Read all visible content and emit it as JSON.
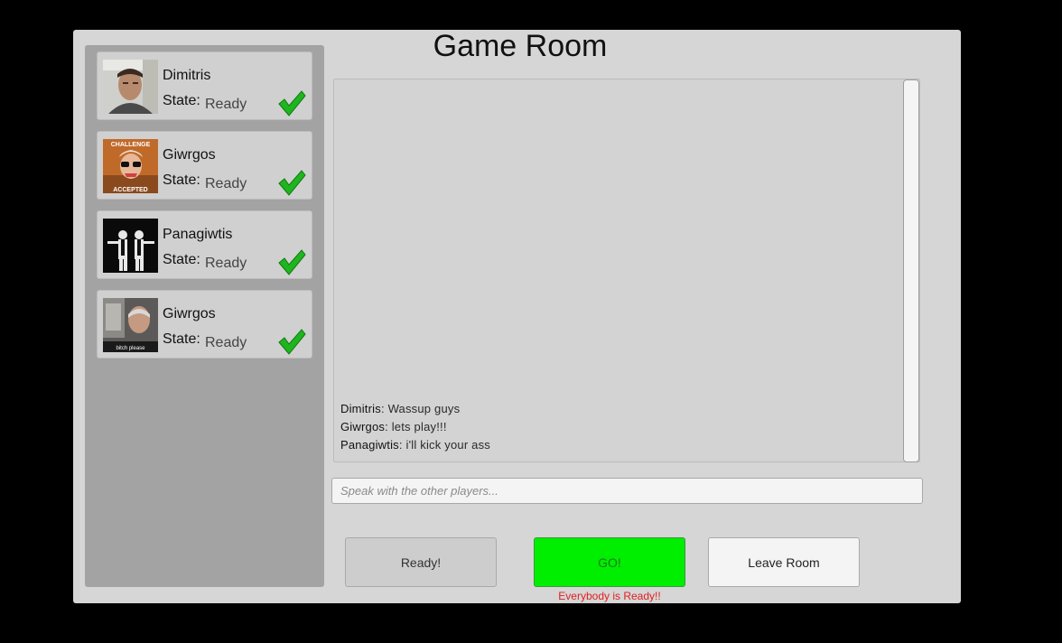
{
  "room": {
    "title": "Game Room"
  },
  "players": [
    {
      "name": "Dimitris",
      "state_label": "State:",
      "state": "Ready",
      "avatar_icon": "portrait-man-icon"
    },
    {
      "name": "Giwrgos",
      "state_label": "State:",
      "state": "Ready",
      "avatar_icon": "challenge-accepted-meme-icon",
      "avatar_text_top": "CHALLENGE",
      "avatar_text_bottom": "ACCEPTED"
    },
    {
      "name": "Panagiwtis",
      "state_label": "State:",
      "state": "Ready",
      "avatar_icon": "pulp-fiction-silhouette-icon"
    },
    {
      "name": "Giwrgos",
      "state_label": "State:",
      "state": "Ready",
      "avatar_icon": "car-meme-icon",
      "avatar_text_bottom": "bitch please"
    }
  ],
  "chat": {
    "messages": [
      {
        "sender": "Dimitris",
        "separator": ": ",
        "text": "Wassup guys"
      },
      {
        "sender": "Giwrgos",
        "separator": ": ",
        "text": "lets play!!!"
      },
      {
        "sender": "Panagiwtis",
        "separator": ": ",
        "text": "i'll kick your ass"
      }
    ],
    "input_placeholder": "Speak with the other players...",
    "input_value": ""
  },
  "buttons": {
    "ready_label": "Ready!",
    "go_label": "GO!",
    "leave_label": "Leave Room"
  },
  "status": {
    "text": "Everybody is Ready!!"
  },
  "colors": {
    "go_button": "#00ee00",
    "ready_check": "#1fb51f",
    "status_text": "#e02020",
    "panel_bg": "#d6d6d6",
    "player_list_bg": "#a3a3a3"
  }
}
